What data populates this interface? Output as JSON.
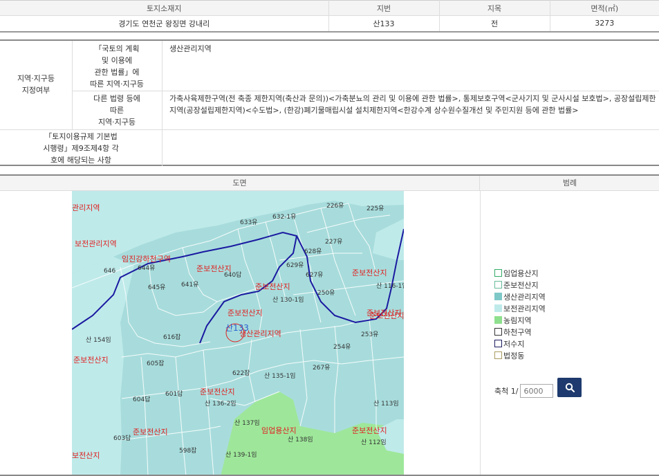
{
  "land": {
    "headers": [
      "토지소재지",
      "지번",
      "지목",
      "면적(㎡)"
    ],
    "values": [
      "경기도 연천군 왕징면 강내리",
      "산133",
      "전",
      "3273"
    ]
  },
  "zoning": {
    "row_header": [
      "지역·지구등",
      "지정여부"
    ],
    "sub1": [
      "「국토의 계획",
      "및 이용에",
      "관한 법률」에",
      "따른 지역·지구등"
    ],
    "val1": "생산관리지역",
    "sub2": [
      "다른 법령 등에",
      "따른",
      "지역·지구등"
    ],
    "val2": [
      "가축사육제한구역(전 축종 제한지역(축산과 문의))<가축분뇨의 관리 및 이용에 관한 법률>, 통제보호구역<군사기지 및 군사시설 보호법>, 공장설립제한",
      "지역(공장설립제한지역)<수도법>, (한강)폐기물매립시설 설치제한지역<한강수계 상수원수질개선 및 주민지원 등에 관한 법률>"
    ],
    "sub3": [
      "「토지이용규제 기본법",
      "시행령」제9조제4항 각",
      "호에 해당되는 사항"
    ]
  },
  "map_section": {
    "title": "도면",
    "legend_title": "범례",
    "labels": {
      "zones": [
        "관리지역",
        "보전관리지역",
        "임진강하천구역",
        "준보전산지",
        "준보전산지",
        "준보전산지",
        "준보전산지",
        "생산관리지역",
        "준보전산지",
        "준보전산지",
        "준보전산지",
        "준보전산지",
        "임업용산지",
        "준보전산지",
        "보전산지",
        "준보전산지"
      ],
      "subject": "산133",
      "parcels": [
        "226유",
        "225유",
        "633유",
        "632-1유",
        "227유",
        "628유",
        "629유",
        "627유",
        "250유",
        "646",
        "644유",
        "645유",
        "641유",
        "640답",
        "616잡",
        "605잡",
        "622잡",
        "산 135-1임",
        "산 154임",
        "601답",
        "604답",
        "603답",
        "598잡",
        "산 137임",
        "산 136-2임",
        "산 139-1임",
        "산 138임",
        "산 112임",
        "산 113임",
        "산 116-1임",
        "253유",
        "254유",
        "산 130-1임",
        "267유"
      ]
    },
    "legend": [
      {
        "label": "임업용산지",
        "color": "#ffffff"
      },
      {
        "label": "준보전산지",
        "color": "#ffffff"
      },
      {
        "label": "생산관리지역",
        "color": "#7ec8c8"
      },
      {
        "label": "보전관리지역",
        "color": "#bfeaea"
      },
      {
        "label": "농림지역",
        "color": "#8ee08e"
      },
      {
        "label": "하천구역",
        "color": "#ffffff"
      },
      {
        "label": "저수지",
        "color": "#ffffff"
      },
      {
        "label": "법정동",
        "color": "#ffffff"
      }
    ],
    "scale_label": "축척 1/",
    "scale_placeholder": "6000",
    "search_icon": "search-icon"
  },
  "colors": {
    "header_bg": "#f4f4f4",
    "map_base": "#a8dcdc",
    "label_red": "#e02020",
    "boundary_blue": "#1a1aa0",
    "button_navy": "#1e3a6e"
  }
}
